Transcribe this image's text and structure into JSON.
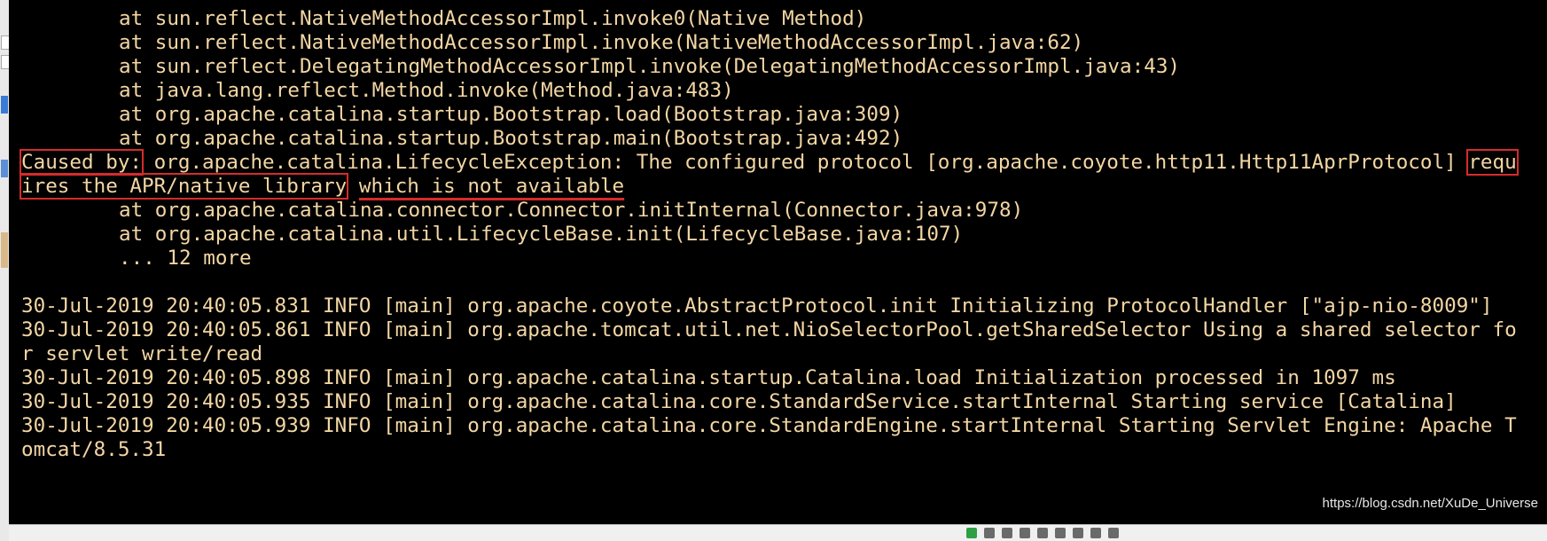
{
  "console": {
    "stack_top": [
      "at sun.reflect.NativeMethodAccessorImpl.invoke0(Native Method)",
      "at sun.reflect.NativeMethodAccessorImpl.invoke(NativeMethodAccessorImpl.java:62)",
      "at sun.reflect.DelegatingMethodAccessorImpl.invoke(DelegatingMethodAccessorImpl.java:43)",
      "at java.lang.reflect.Method.invoke(Method.java:483)",
      "at org.apache.catalina.startup.Bootstrap.load(Bootstrap.java:309)",
      "at org.apache.catalina.startup.Bootstrap.main(Bootstrap.java:492)"
    ],
    "caused_by": {
      "label": "Caused by:",
      "text": " org.apache.catalina.LifecycleException: The configured protocol [org.apache.coyote.http11.Http11AprProtocol] ",
      "highlight_end": "requ",
      "line2_highlight": "ires the APR/native library",
      "line2_gap": " ",
      "line2_underline": "which is not available"
    },
    "stack_bottom": [
      "at org.apache.catalina.connector.Connector.initInternal(Connector.java:978)",
      "at org.apache.catalina.util.LifecycleBase.init(LifecycleBase.java:107)",
      "... 12 more"
    ],
    "log_lines": [
      "30-Jul-2019 20:40:05.831 INFO [main] org.apache.coyote.AbstractProtocol.init Initializing ProtocolHandler [\"ajp-nio-8009\"]",
      "30-Jul-2019 20:40:05.861 INFO [main] org.apache.tomcat.util.net.NioSelectorPool.getSharedSelector Using a shared selector fo",
      "r servlet write/read",
      "30-Jul-2019 20:40:05.898 INFO [main] org.apache.catalina.startup.Catalina.load Initialization processed in 1097 ms",
      "30-Jul-2019 20:40:05.935 INFO [main] org.apache.catalina.core.StandardService.startInternal Starting service [Catalina]",
      "30-Jul-2019 20:40:05.939 INFO [main] org.apache.catalina.core.StandardEngine.startInternal Starting Servlet Engine: Apache T",
      "omcat/8.5.31"
    ]
  },
  "watermark": "https://blog.csdn.net/XuDe_Universe",
  "colors": {
    "console_bg": "#000000",
    "console_text": "#f3d6a4",
    "highlight": "#d62b2b"
  }
}
